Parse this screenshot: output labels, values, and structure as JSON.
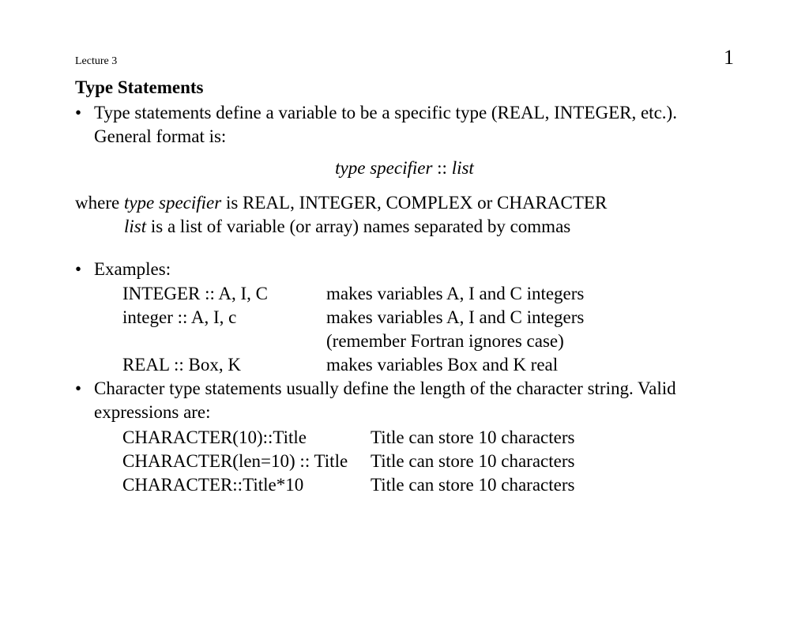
{
  "header": {
    "lecture": "Lecture 3",
    "page": "1"
  },
  "title": "Type Statements",
  "bullet1": {
    "marker": "•",
    "text": "Type statements define a variable to be a specific type (REAL, INTEGER, etc.).  General format is:"
  },
  "center": {
    "italic1": "type specifier",
    "sep": " :: ",
    "italic2": "list"
  },
  "where": {
    "prefix": "where ",
    "italic1": "type specifier",
    "rest1": " is REAL, INTEGER, COMPLEX or CHARACTER",
    "italic2": "list",
    "rest2": "   is a list of variable (or array) names separated by commas"
  },
  "bullet2": {
    "marker": "•",
    "text": "Examples:"
  },
  "examples": [
    {
      "col1": "INTEGER :: A, I, C",
      "col2": "makes variables A, I and C integers"
    },
    {
      "col1": "integer :: A, I, c",
      "col2": "makes variables A, I and C integers"
    },
    {
      "col1": "",
      "col2": "(remember Fortran ignores case)"
    },
    {
      "col1": "REAL :: Box, K",
      "col2": "makes variables Box and K real"
    }
  ],
  "bullet3": {
    "marker": "•",
    "text": "Character type statements usually define the length of the character string.  Valid expressions are:"
  },
  "chars": [
    {
      "col1": "CHARACTER(10)::Title",
      "col2": "Title can store 10 characters"
    },
    {
      "col1": "CHARACTER(len=10) :: Title",
      "col2": "Title can store 10 characters"
    },
    {
      "col1": "CHARACTER::Title*10",
      "col2": "Title can store 10 characters"
    }
  ]
}
